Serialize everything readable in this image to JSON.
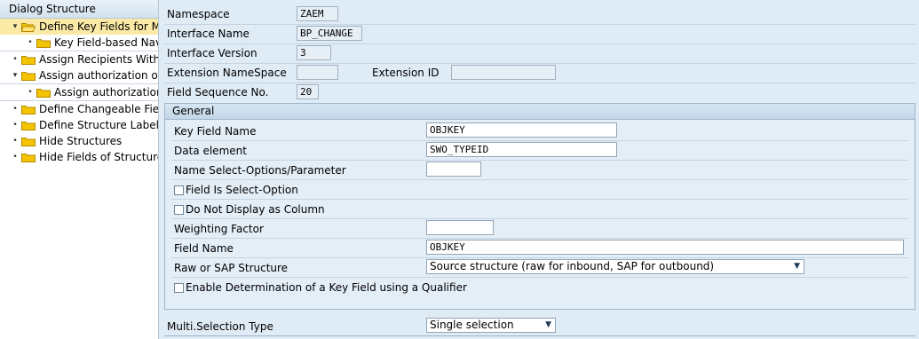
{
  "tree": {
    "title": "Dialog Structure",
    "nodes": [
      {
        "label": "Define Key Fields for Mu",
        "marker": "▾",
        "level": 0,
        "selected": true,
        "open": true
      },
      {
        "label": "Key Field-based Navig",
        "marker": "•",
        "level": 1
      },
      {
        "label": "Assign Recipients Withou",
        "marker": "•",
        "level": 0
      },
      {
        "label": "Assign authorization obje",
        "marker": "▾",
        "level": 0
      },
      {
        "label": "Assign authorization f",
        "marker": "•",
        "level": 1
      },
      {
        "label": "Define Changeable Fields",
        "marker": "•",
        "level": 0
      },
      {
        "label": "Define Structure Labels",
        "marker": "•",
        "level": 0
      },
      {
        "label": "Hide Structures",
        "marker": "•",
        "level": 0
      },
      {
        "label": "Hide Fields of Structure",
        "marker": "•",
        "level": 0
      }
    ]
  },
  "header": {
    "namespace_label": "Namespace",
    "namespace_value": "ZAEM",
    "interface_name_label": "Interface Name",
    "interface_name_value": "BP_CHANGE",
    "interface_version_label": "Interface Version",
    "interface_version_value": "3",
    "ext_namespace_label": "Extension NameSpace",
    "ext_namespace_value": "",
    "ext_id_label": "Extension ID",
    "ext_id_value": "",
    "field_seq_label": "Field Sequence No.",
    "field_seq_value": "20"
  },
  "general": {
    "title": "General",
    "key_field_name_label": "Key Field Name",
    "key_field_name_value": "OBJKEY",
    "data_element_label": "Data element",
    "data_element_value": "SWO_TYPEID",
    "name_select_label": "Name Select-Options/Parameter",
    "name_select_value": "",
    "field_is_select_label": "Field Is Select-Option",
    "do_not_display_label": "Do Not Display as Column",
    "weighting_label": "Weighting Factor",
    "weighting_value": "",
    "field_name_label": "Field Name",
    "field_name_value": "OBJKEY",
    "raw_sap_label": "Raw or SAP Structure",
    "raw_sap_value": "Source structure (raw for inbound, SAP for outbound)",
    "enable_determination_label": "Enable Determination of a Key Field using a Qualifier"
  },
  "multi": {
    "label": "Multi.Selection Type",
    "value": "Single selection"
  },
  "colors": {
    "selected_node": "#fbe9a6",
    "folder": "#f5c400",
    "background": "#dfebf5"
  },
  "icons": {
    "folder": "folder-icon",
    "dropdown": "dropdown-arrow-icon"
  }
}
